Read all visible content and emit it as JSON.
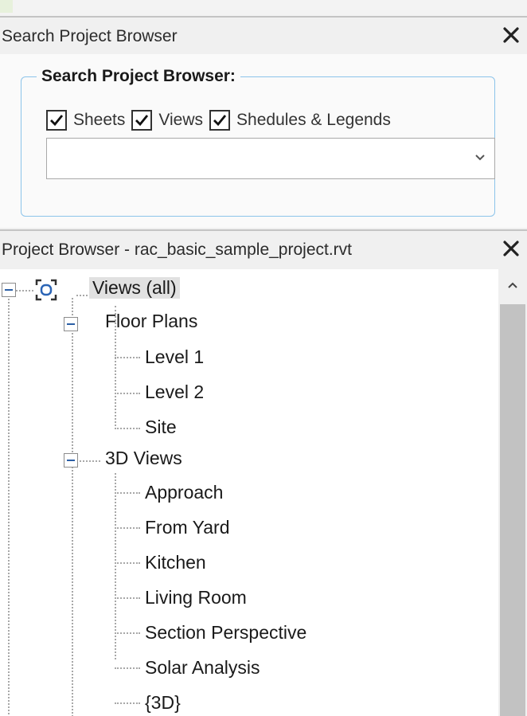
{
  "search_panel": {
    "title": "Search Project Browser",
    "close_glyph": "✕",
    "group_label": "Search Project Browser:",
    "checkboxes": [
      {
        "label": "Sheets",
        "checked": true
      },
      {
        "label": "Views",
        "checked": true
      },
      {
        "label": "Shedules & Legends",
        "checked": true
      }
    ],
    "search_value": ""
  },
  "project_browser": {
    "title": "Project Browser - rac_basic_sample_project.rvt",
    "close_glyph": "✕",
    "root": {
      "label": "Views (all)",
      "icon": "views-icon",
      "expanded": true,
      "selected": true
    },
    "groups": [
      {
        "label": "Floor Plans",
        "expanded": true,
        "items": [
          "Level 1",
          "Level 2",
          "Site"
        ]
      },
      {
        "label": "3D Views",
        "expanded": true,
        "items": [
          "Approach",
          "From Yard",
          "Kitchen",
          "Living Room",
          "Section Perspective",
          "Solar Analysis",
          "{3D}"
        ]
      }
    ]
  },
  "colors": {
    "groupbox_border": "#8cc4ea",
    "selection_bg": "#e1e1e1",
    "scroll_thumb": "#c2c2c2",
    "expander_minus": "#2b5fa5"
  }
}
